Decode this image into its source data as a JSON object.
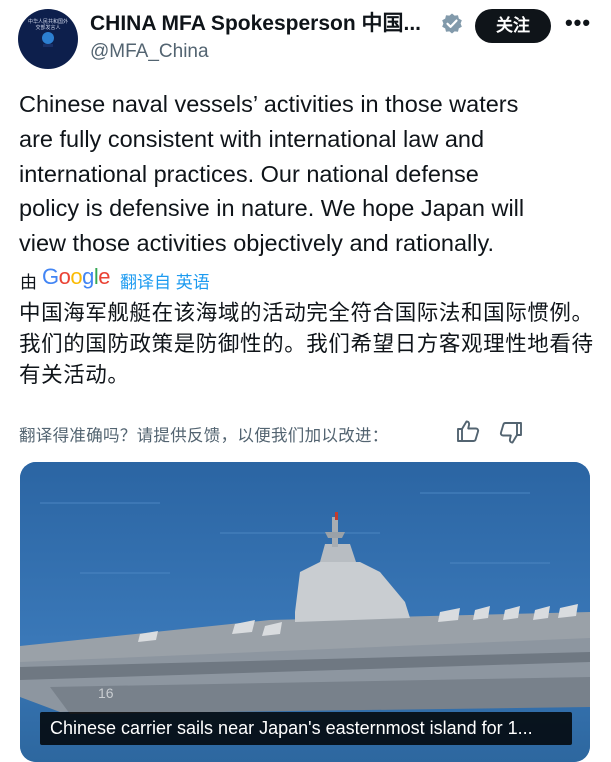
{
  "author": {
    "name": "CHINA MFA Spokesperson 中国...",
    "handle": "@MFA_China",
    "avatar_text": "中华人民共和国外交部发言人"
  },
  "follow_label": "关注",
  "more_label": "•••",
  "tweet": {
    "text": "Chinese naval vessels’ activities in those waters\nare fully consistent with international law and\ninternational practices. Our national defense\npolicy is defensive in nature. We hope Japan will\nview those activities objectively and rationally."
  },
  "translation": {
    "by": "由",
    "google": [
      "G",
      "o",
      "o",
      "g",
      "l",
      "e"
    ],
    "google_colors": [
      "#4285f4",
      "#ea4335",
      "#fbbc05",
      "#4285f4",
      "#34a853",
      "#ea4335"
    ],
    "translated_from": "翻译自 英语",
    "text": "中国海军舰艇在该海域的活动完全符合国际法和国际惯例。我们的国防政策是防御性的。我们希望日方客观理性地看待有关活动。",
    "feedback": "翻译得准确吗？请提供反馈，以便我们加以改进："
  },
  "media": {
    "caption": "Chinese carrier sails near Japan's easternmost island for 1...",
    "hull_number": "16"
  },
  "colors": {
    "link": "#1d9bf0",
    "secondary": "#536471",
    "verified": "#829aab"
  }
}
